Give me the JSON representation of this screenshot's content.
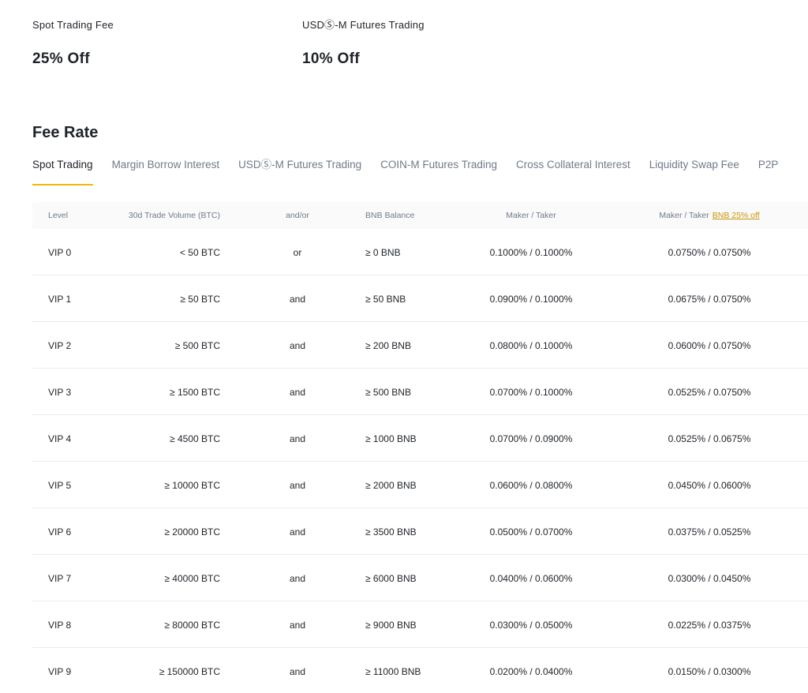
{
  "discounts": [
    {
      "label": "Spot Trading Fee",
      "value": "25% Off"
    },
    {
      "label": "USDⓈ-M Futures Trading",
      "value": "10% Off"
    }
  ],
  "section_title": "Fee Rate",
  "tabs": [
    {
      "label": "Spot Trading",
      "active": true
    },
    {
      "label": "Margin Borrow Interest",
      "active": false
    },
    {
      "label": "USDⓈ-M Futures Trading",
      "active": false
    },
    {
      "label": "COIN-M Futures Trading",
      "active": false
    },
    {
      "label": "Cross Collateral Interest",
      "active": false
    },
    {
      "label": "Liquidity Swap Fee",
      "active": false
    },
    {
      "label": "P2P",
      "active": false
    }
  ],
  "table": {
    "headers": {
      "level": "Level",
      "volume": "30d Trade Volume (BTC)",
      "andor": "and/or",
      "bnb": "BNB Balance",
      "maker_taker": "Maker / Taker",
      "maker_taker_bnb": "Maker / Taker",
      "bnb_discount_link": "BNB 25% off"
    },
    "rows": [
      {
        "level": "VIP 0",
        "volume": "< 50 BTC",
        "andor": "or",
        "bnb": "≥ 0 BNB",
        "fee": "0.1000% / 0.1000%",
        "fee_bnb": "0.0750% / 0.0750%"
      },
      {
        "level": "VIP 1",
        "volume": "≥ 50 BTC",
        "andor": "and",
        "bnb": "≥ 50 BNB",
        "fee": "0.0900% / 0.1000%",
        "fee_bnb": "0.0675% / 0.0750%"
      },
      {
        "level": "VIP 2",
        "volume": "≥ 500 BTC",
        "andor": "and",
        "bnb": "≥ 200 BNB",
        "fee": "0.0800% / 0.1000%",
        "fee_bnb": "0.0600% / 0.0750%"
      },
      {
        "level": "VIP 3",
        "volume": "≥ 1500 BTC",
        "andor": "and",
        "bnb": "≥ 500 BNB",
        "fee": "0.0700% / 0.1000%",
        "fee_bnb": "0.0525% / 0.0750%"
      },
      {
        "level": "VIP 4",
        "volume": "≥ 4500 BTC",
        "andor": "and",
        "bnb": "≥ 1000 BNB",
        "fee": "0.0700% / 0.0900%",
        "fee_bnb": "0.0525% / 0.0675%"
      },
      {
        "level": "VIP 5",
        "volume": "≥ 10000 BTC",
        "andor": "and",
        "bnb": "≥ 2000 BNB",
        "fee": "0.0600% / 0.0800%",
        "fee_bnb": "0.0450% / 0.0600%"
      },
      {
        "level": "VIP 6",
        "volume": "≥ 20000 BTC",
        "andor": "and",
        "bnb": "≥ 3500 BNB",
        "fee": "0.0500% / 0.0700%",
        "fee_bnb": "0.0375% / 0.0525%"
      },
      {
        "level": "VIP 7",
        "volume": "≥ 40000 BTC",
        "andor": "and",
        "bnb": "≥ 6000 BNB",
        "fee": "0.0400% / 0.0600%",
        "fee_bnb": "0.0300% / 0.0450%"
      },
      {
        "level": "VIP 8",
        "volume": "≥ 80000 BTC",
        "andor": "and",
        "bnb": "≥ 9000 BNB",
        "fee": "0.0300% / 0.0500%",
        "fee_bnb": "0.0225% / 0.0375%"
      },
      {
        "level": "VIP 9",
        "volume": "≥ 150000 BTC",
        "andor": "and",
        "bnb": "≥ 11000 BNB",
        "fee": "0.0200% / 0.0400%",
        "fee_bnb": "0.0150% / 0.0300%"
      }
    ]
  },
  "colors": {
    "accent": "#f0b90b",
    "link": "#c99400",
    "text": "#1e2329",
    "muted": "#707a8a",
    "header_bg": "#fafafa",
    "divider": "#eaecef"
  }
}
